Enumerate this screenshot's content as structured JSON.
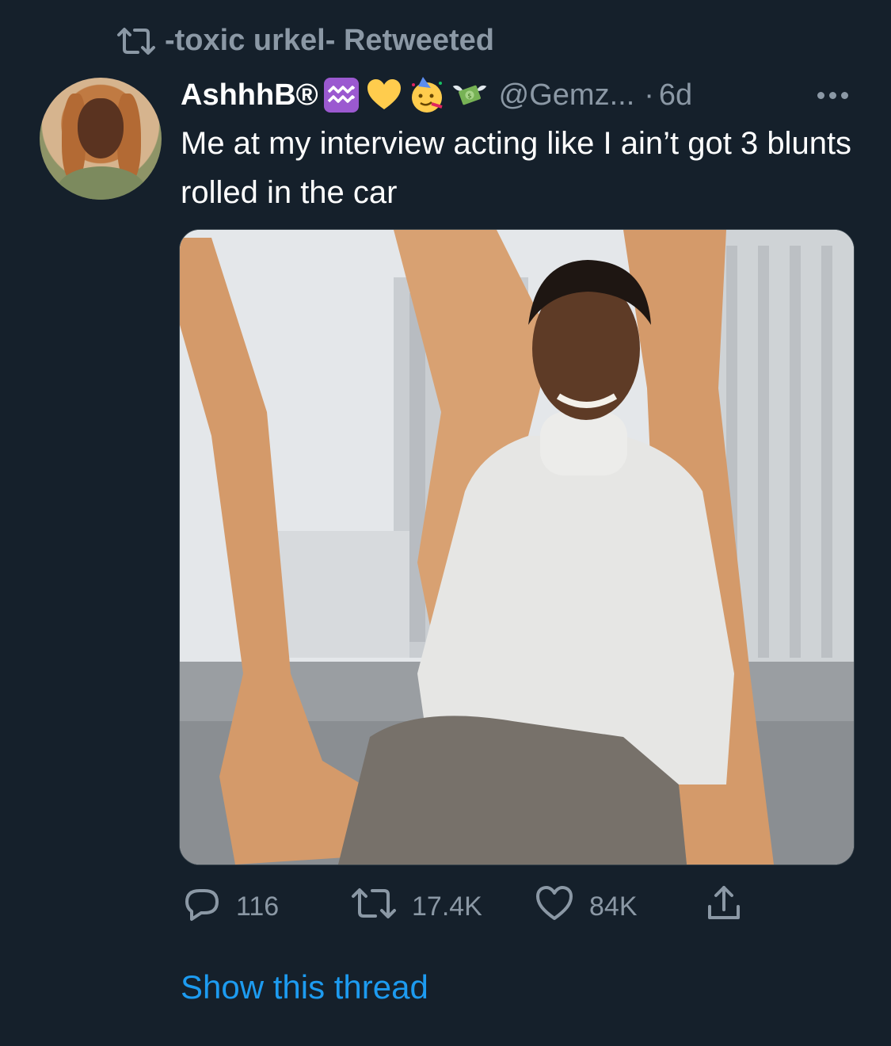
{
  "retweet": {
    "icon": "retweet-icon",
    "text": "-toxic urkel- Retweeted"
  },
  "tweet": {
    "display_name": "AshhhB®",
    "emojis": [
      "aquarius-icon",
      "yellow-heart-icon",
      "party-face-icon",
      "money-with-wings-icon"
    ],
    "handle": "@Gemz...",
    "dot": "·",
    "time": "6d",
    "text": "Me at my interview acting like I ain’t got 3 blunts rolled in the car"
  },
  "actions": {
    "reply_count": "116",
    "retweet_count": "17.4K",
    "like_count": "84K"
  },
  "thread_link": "Show this thread",
  "colors": {
    "background": "#15202b",
    "secondary_text": "#8b98a5",
    "link": "#1d9bf0",
    "aquarius_bg": "#9b59d0",
    "heart": "#ffcc4d"
  }
}
